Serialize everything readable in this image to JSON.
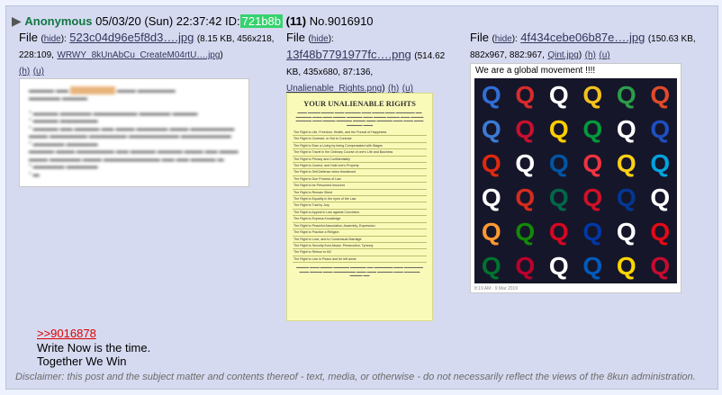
{
  "post": {
    "name": "Anonymous",
    "datetime": "05/03/20 (Sun) 22:37:42",
    "id_label": "ID:",
    "poster_id": "721b8b",
    "post_count": "(11)",
    "no_label": "No.",
    "post_number": "9016910",
    "files": [
      {
        "label": "File",
        "hide": "hide",
        "filename": "523c04d96e5f8d3….jpg",
        "meta": "(8.15 KB, 456x218, 228:109,",
        "orig_name": "WRWY_8kUnAbCu_CreateM04rtU….jpg",
        "close_paren": ")",
        "h": "(h)",
        "u": "(u)"
      },
      {
        "label": "File",
        "hide": "hide",
        "filename": "13f48b7791977fc….png",
        "meta": "(514.62 KB, 435x680, 87:136,",
        "orig_name": "Unalienable_Rights.png",
        "close_paren": ")",
        "h": "(h)",
        "u": "(u)"
      },
      {
        "label": "File",
        "hide": "hide",
        "filename": "4f434cebe06b87e….jpg",
        "meta": "(150.63 KB, 882x967, 882:967,",
        "orig_name": "Qint.jpg",
        "close_paren": ")",
        "h": "(h)",
        "u": "(u)"
      }
    ],
    "body": {
      "quote_link": ">>9016878",
      "line1": "Write Now is the time.",
      "line2": "Together We Win"
    }
  },
  "image3": {
    "caption": "We are a global movement !!!!",
    "q_glyph": "Q",
    "q_colors": [
      "#2f6fd6",
      "#d92b2b",
      "#ffffff",
      "#f2c21b",
      "#2a9d4a",
      "#e04a2a",
      "#3a7bd5",
      "#c8102e",
      "#ffce00",
      "#009b3a",
      "#ffffff",
      "#1f4fbf",
      "#de2910",
      "#ffffff",
      "#0055a4",
      "#ef3340",
      "#fcd116",
      "#00a3dd",
      "#ffffff",
      "#d52b1e",
      "#006847",
      "#ce1126",
      "#003893",
      "#ffffff",
      "#ff9933",
      "#138808",
      "#d80621",
      "#0038a8",
      "#ffffff",
      "#e30a17",
      "#00732f",
      "#bc002d",
      "#ffffff",
      "#005bbb",
      "#ffd500",
      "#c60c30"
    ]
  },
  "disclaimer": "Disclaimer: this post and the subject matter and contents thereof - text, media, or otherwise - do not necessarily reflect the views of the 8kun administration."
}
